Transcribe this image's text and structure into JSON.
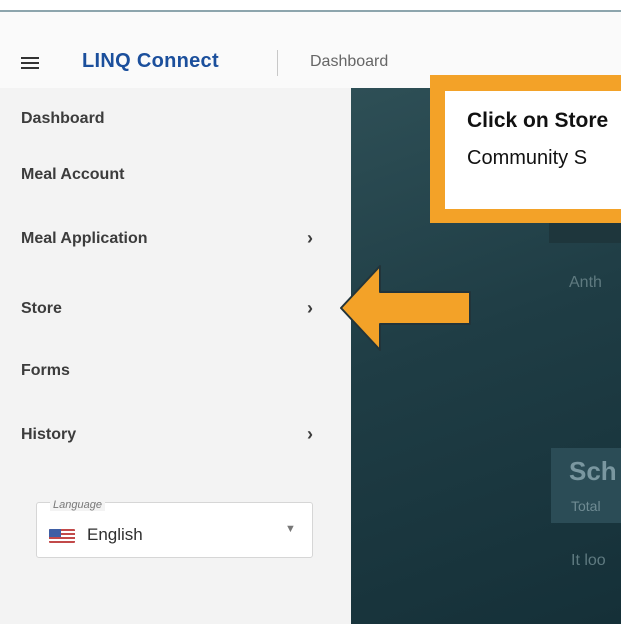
{
  "header": {
    "brand": "LINQ Connect",
    "breadcrumb": "Dashboard"
  },
  "sidebar": {
    "items": [
      {
        "label": "Dashboard",
        "has_chevron": false
      },
      {
        "label": "Meal Account",
        "has_chevron": false
      },
      {
        "label": "Meal Application",
        "has_chevron": true
      },
      {
        "label": "Store",
        "has_chevron": true
      },
      {
        "label": "Forms",
        "has_chevron": false
      },
      {
        "label": "History",
        "has_chevron": true
      }
    ],
    "language": {
      "legend": "Language",
      "value": "English"
    }
  },
  "main": {
    "line1": "Anth",
    "school_title": "Sch",
    "school_sub": "Total",
    "line2": "It loo"
  },
  "callout": {
    "line1": "Click on Store",
    "line2": "Community S"
  },
  "colors": {
    "brand": "#1b4f9c",
    "callout_accent": "#f3a228",
    "main_bg": "#1f3d45",
    "sidebar_bg": "#f3f3f3"
  },
  "icons": {
    "menu": "hamburger-icon",
    "chevron": "chevron-right-icon",
    "flag": "us-flag-icon",
    "caret": "caret-down-icon",
    "arrow": "pointer-arrow-icon"
  }
}
